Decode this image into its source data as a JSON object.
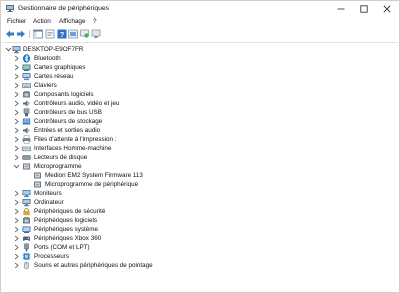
{
  "window": {
    "title": "Gestionnaire de périphériques"
  },
  "menu": [
    {
      "label": "Fichier"
    },
    {
      "label": "Action"
    },
    {
      "label": "Affichage"
    },
    {
      "label": "?"
    }
  ],
  "tree": {
    "root": {
      "label": "DESKTOP-E9OF7FR",
      "icon": "computer-icon"
    },
    "items": [
      {
        "label": "Bluetooth",
        "icon": "bluetooth-icon",
        "expanded": false
      },
      {
        "label": "Cartes graphiques",
        "icon": "display-adapter-icon",
        "expanded": false
      },
      {
        "label": "Cartes réseau",
        "icon": "network-adapter-icon",
        "expanded": false
      },
      {
        "label": "Claviers",
        "icon": "keyboard-icon",
        "expanded": false
      },
      {
        "label": "Composants logiciels",
        "icon": "software-component-icon",
        "expanded": false
      },
      {
        "label": "Contrôleurs audio, vidéo et jeu",
        "icon": "audio-icon",
        "expanded": false
      },
      {
        "label": "Contrôleurs de bus USB",
        "icon": "usb-icon",
        "expanded": false
      },
      {
        "label": "Contrôleurs de stockage",
        "icon": "storage-controller-icon",
        "expanded": false
      },
      {
        "label": "Entrées et sorties audio",
        "icon": "audio-io-icon",
        "expanded": false
      },
      {
        "label": "Files d'attente à l'impression :",
        "icon": "print-queue-icon",
        "expanded": false
      },
      {
        "label": "Interfaces Homme-machine",
        "icon": "hid-icon",
        "expanded": false
      },
      {
        "label": "Lecteurs de disque",
        "icon": "disk-drive-icon",
        "expanded": false
      },
      {
        "label": "Microprogramme",
        "icon": "firmware-icon",
        "expanded": true,
        "children": [
          {
            "label": "Medion EM2 System Firmware 113",
            "icon": "firmware-device-icon"
          },
          {
            "label": "Microprogramme de périphérique",
            "icon": "firmware-device-icon"
          }
        ]
      },
      {
        "label": "Moniteurs",
        "icon": "monitor-icon",
        "expanded": false
      },
      {
        "label": "Ordinateur",
        "icon": "computer-icon",
        "expanded": false
      },
      {
        "label": "Périphériques de sécurité",
        "icon": "security-device-icon",
        "expanded": false
      },
      {
        "label": "Périphériques logiciels",
        "icon": "software-device-icon",
        "expanded": false
      },
      {
        "label": "Périphériques système",
        "icon": "system-device-icon",
        "expanded": false
      },
      {
        "label": "Périphériques Xbox 360",
        "icon": "xbox-icon",
        "expanded": false
      },
      {
        "label": "Ports (COM et LPT)",
        "icon": "port-icon",
        "expanded": false
      },
      {
        "label": "Processeurs",
        "icon": "processor-icon",
        "expanded": false
      },
      {
        "label": "Souris et autres périphériques de pointage",
        "icon": "mouse-icon",
        "expanded": false
      }
    ]
  }
}
